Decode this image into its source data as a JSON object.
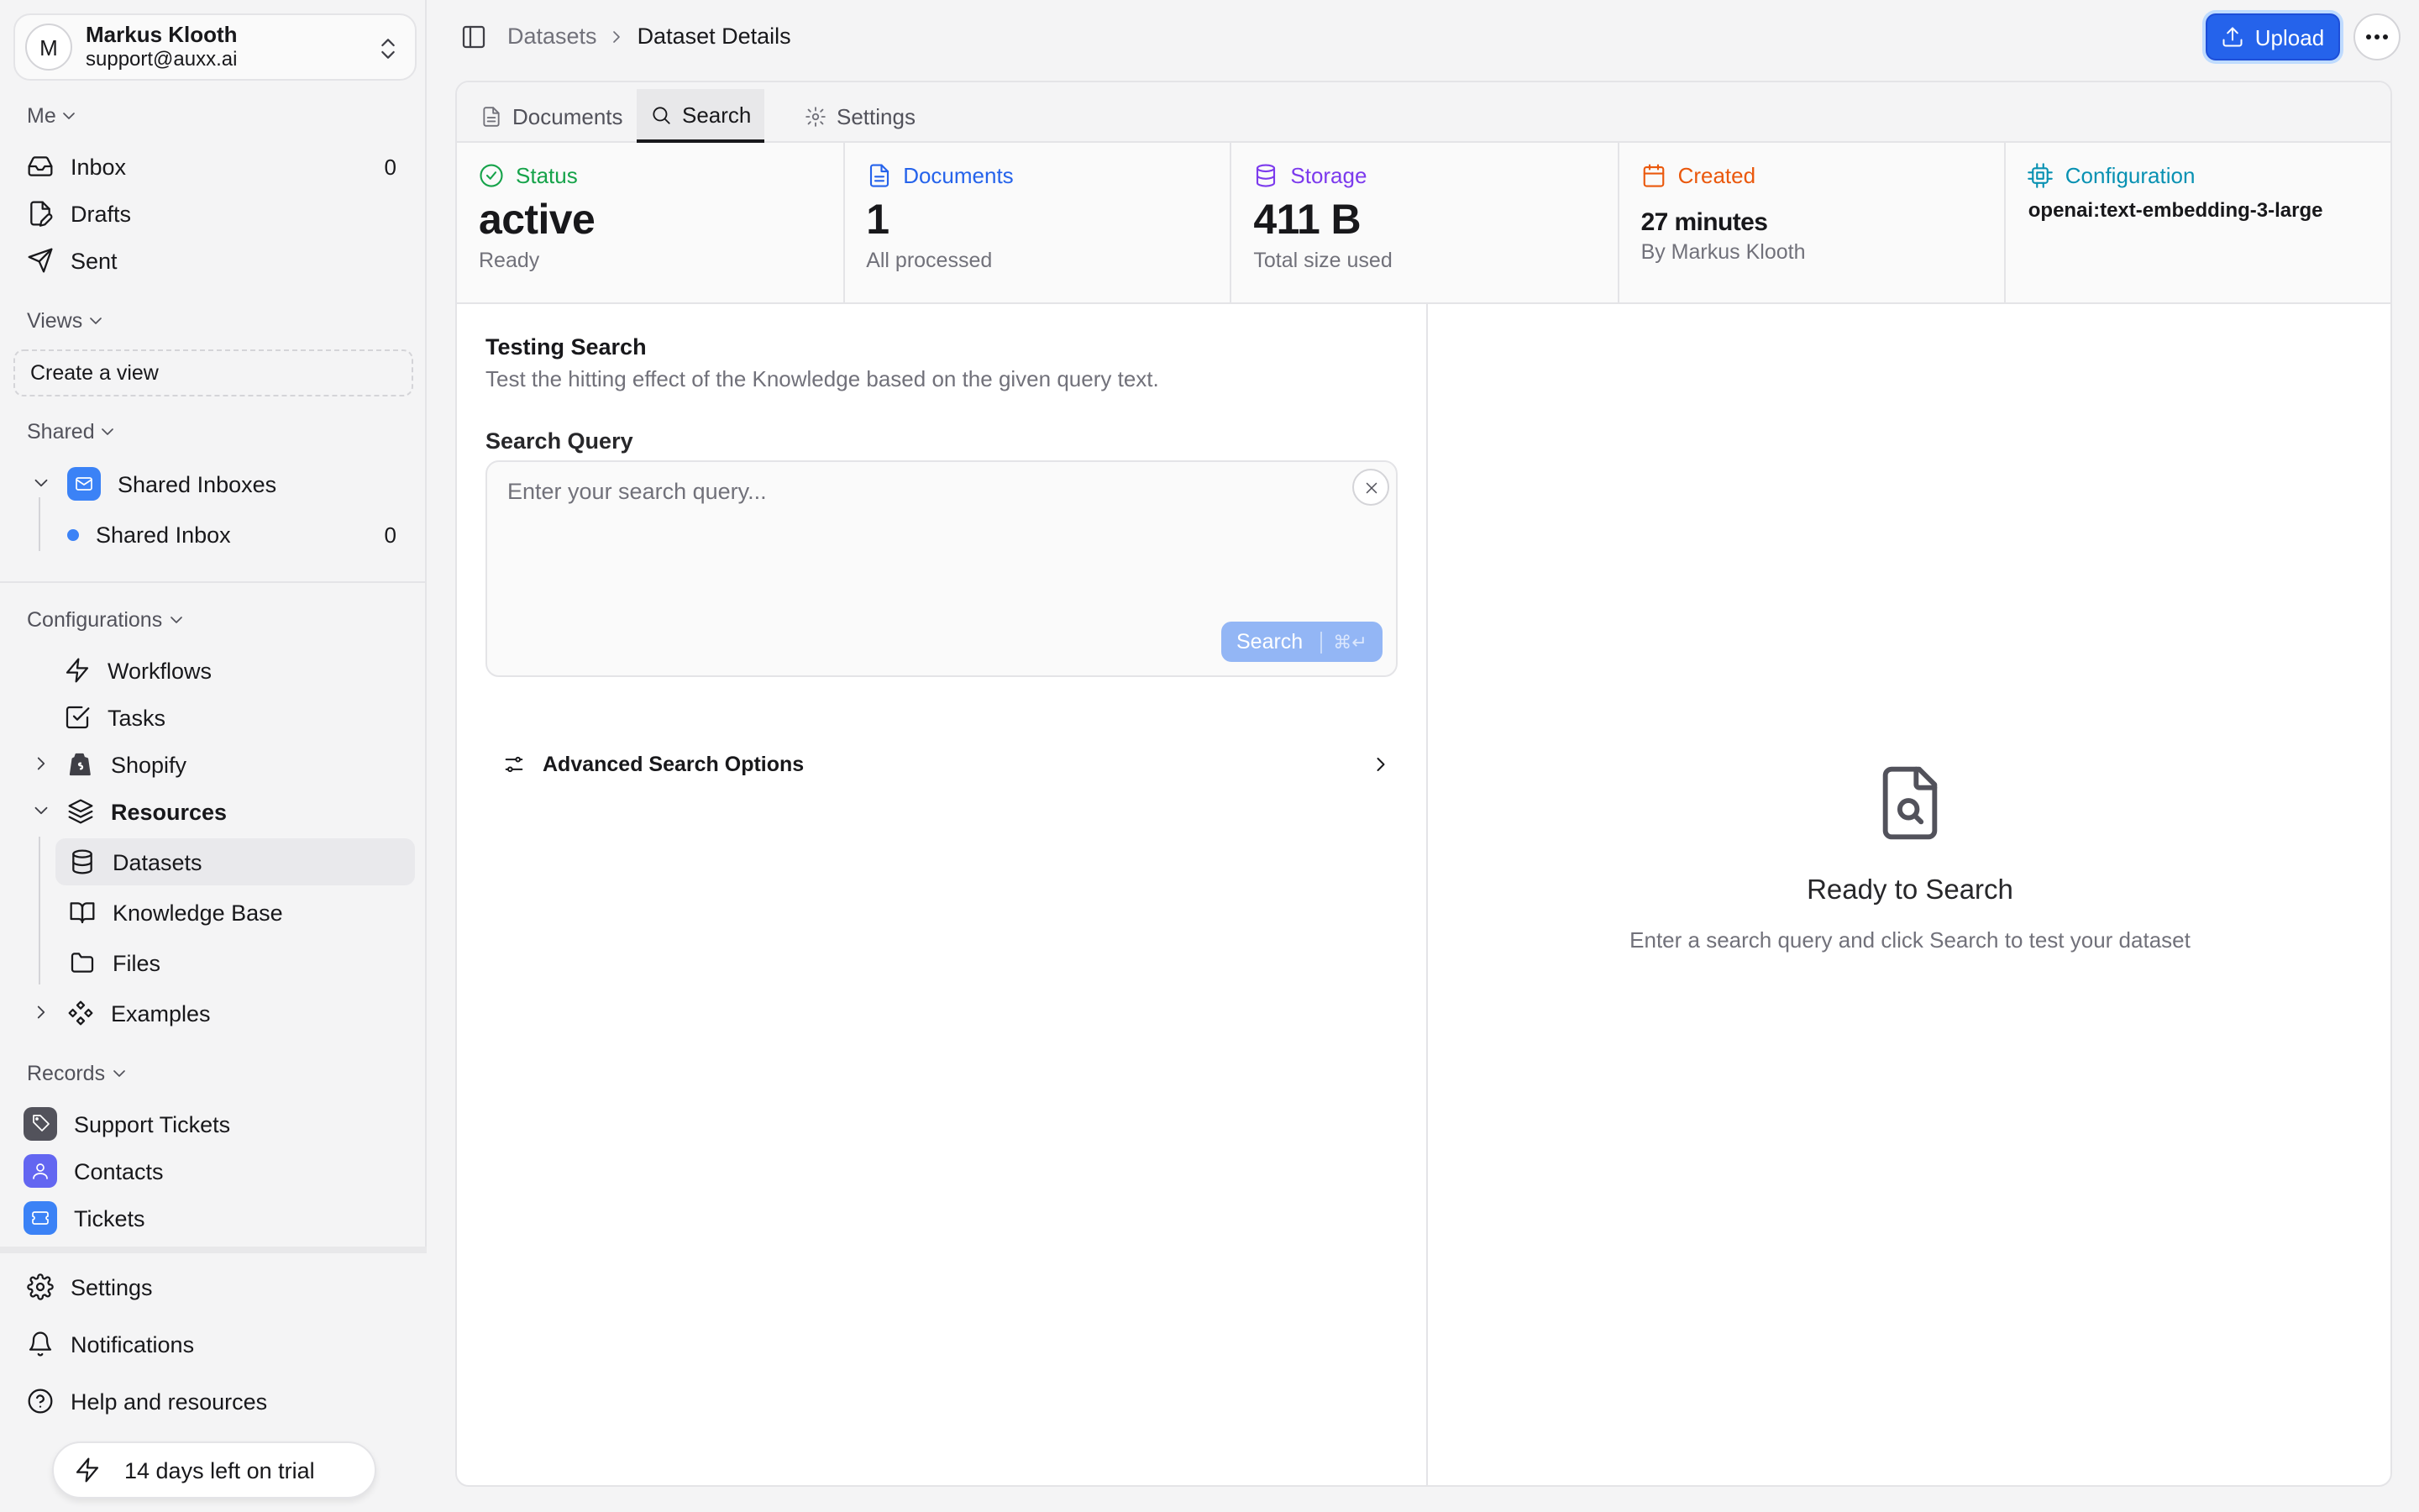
{
  "account": {
    "initial": "M",
    "name": "Markus Klooth",
    "email": "support@auxx.ai"
  },
  "sidebar": {
    "me_section": "Me",
    "inbox": {
      "label": "Inbox",
      "count": "0"
    },
    "drafts": "Drafts",
    "sent": "Sent",
    "views_section": "Views",
    "create_view": "Create a view",
    "shared_section": "Shared",
    "shared_inboxes": "Shared Inboxes",
    "shared_inbox": {
      "label": "Shared Inbox",
      "count": "0"
    },
    "configurations_section": "Configurations",
    "workflows": "Workflows",
    "tasks": "Tasks",
    "shopify": "Shopify",
    "resources": "Resources",
    "datasets": "Datasets",
    "knowledge_base": "Knowledge Base",
    "files": "Files",
    "examples": "Examples",
    "records_section": "Records",
    "support_tickets": "Support Tickets",
    "contacts": "Contacts",
    "tickets": "Tickets",
    "settings": "Settings",
    "notifications": "Notifications",
    "help": "Help and resources",
    "trial": "14 days left on trial"
  },
  "breadcrumb": {
    "parent": "Datasets",
    "current": "Dataset Details"
  },
  "toolbar": {
    "upload_label": "Upload"
  },
  "tabs": [
    "Documents",
    "Search",
    "Settings"
  ],
  "stats": {
    "status": {
      "label": "Status",
      "value": "active",
      "sub": "Ready",
      "color": "#16a34a"
    },
    "documents": {
      "label": "Documents",
      "value": "1",
      "sub": "All processed",
      "color": "#2563eb"
    },
    "storage": {
      "label": "Storage",
      "value": "411 B",
      "sub": "Total size used",
      "color": "#7c3aed"
    },
    "created": {
      "label": "Created",
      "value": "27 minutes",
      "sub": "By Markus Klooth",
      "color": "#ea580c"
    },
    "configuration": {
      "label": "Configuration",
      "value": "openai:text-embedding-3-large",
      "color": "#0891b2"
    }
  },
  "testing": {
    "title": "Testing Search",
    "description": "Test the hitting effect of the Knowledge based on the given query text.",
    "query_label": "Search Query",
    "query_placeholder": "Enter your search query...",
    "query_value": "",
    "search_button": "Search",
    "shortcut": "⌘↵",
    "advanced": "Advanced Search Options"
  },
  "empty_state": {
    "title": "Ready to Search",
    "subtitle": "Enter a search query and click Search to test your dataset"
  }
}
